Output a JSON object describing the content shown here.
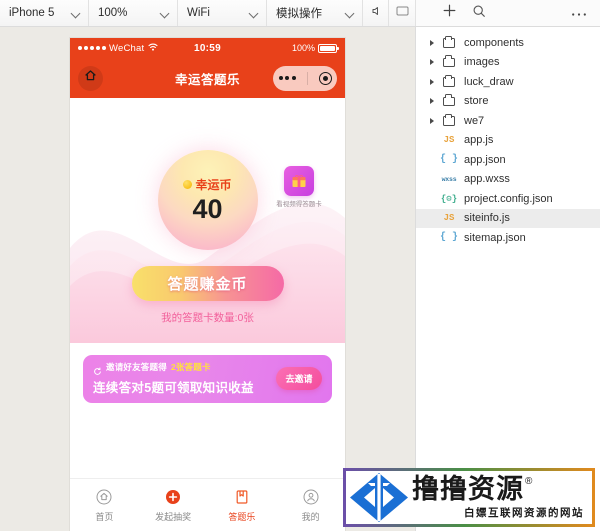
{
  "toolbar": {
    "device": "iPhone 5",
    "zoom": "100%",
    "network": "WiFi",
    "simulate": "模拟操作",
    "sound_icon": "speaker-icon",
    "screen_icon": "monitor-icon",
    "add_icon": "plus-icon",
    "search_icon": "search-icon",
    "more_icon": "more-horizontal-icon"
  },
  "phone": {
    "status": {
      "carrier": "WeChat",
      "time": "10:59",
      "battery": "100%",
      "wifi_icon": "wifi-icon",
      "signal_icon": "signal-dots-icon",
      "battery_icon": "battery-full-icon"
    },
    "nav": {
      "home_icon": "home-icon",
      "title": "幸运答题乐",
      "capsule_more_icon": "ellipsis-icon",
      "capsule_target_icon": "target-icon"
    },
    "hero": {
      "coin_icon": "coin-icon",
      "coin_label": "幸运币",
      "coin_value": "40",
      "video_icon": "gift-video-icon",
      "video_label": "看视频得答题卡",
      "main_button": "答题赚金币",
      "card_count": "我的答题卡数量:0张"
    },
    "invite": {
      "refresh_icon": "refresh-icon",
      "line1_prefix": "邀请好友答题得",
      "line1_highlight": "2张答题卡",
      "line2": "连续答对5题可领取知识收益",
      "button": "去邀请"
    },
    "tabs": [
      {
        "label": "首页",
        "icon": "home-outline-icon",
        "active": false
      },
      {
        "label": "发起抽奖",
        "icon": "plus-circle-icon",
        "active": false
      },
      {
        "label": "答题乐",
        "icon": "book-quiz-icon",
        "active": true
      },
      {
        "label": "我的",
        "icon": "user-circle-icon",
        "active": false
      }
    ]
  },
  "filetree": [
    {
      "name": "components",
      "type": "folder",
      "expandable": true,
      "selected": false,
      "icon": "folder-icon"
    },
    {
      "name": "images",
      "type": "folder",
      "expandable": true,
      "selected": false,
      "icon": "folder-icon"
    },
    {
      "name": "luck_draw",
      "type": "folder",
      "expandable": true,
      "selected": false,
      "icon": "folder-icon"
    },
    {
      "name": "store",
      "type": "folder",
      "expandable": true,
      "selected": false,
      "icon": "folder-icon"
    },
    {
      "name": "we7",
      "type": "folder",
      "expandable": true,
      "selected": false,
      "icon": "folder-icon"
    },
    {
      "name": "app.js",
      "type": "js",
      "expandable": false,
      "selected": false,
      "icon": "js-file-icon",
      "badge": "JS"
    },
    {
      "name": "app.json",
      "type": "json",
      "expandable": false,
      "selected": false,
      "icon": "json-file-icon",
      "badge": "{ }"
    },
    {
      "name": "app.wxss",
      "type": "wxss",
      "expandable": false,
      "selected": false,
      "icon": "wxss-file-icon",
      "badge": "wxss"
    },
    {
      "name": "project.config.json",
      "type": "cfg",
      "expandable": false,
      "selected": false,
      "icon": "config-file-icon",
      "badge": "{⚙}"
    },
    {
      "name": "siteinfo.js",
      "type": "js",
      "expandable": false,
      "selected": true,
      "icon": "js-file-icon",
      "badge": "JS"
    },
    {
      "name": "sitemap.json",
      "type": "json",
      "expandable": false,
      "selected": false,
      "icon": "json-file-icon",
      "badge": "{ }"
    }
  ],
  "watermark": {
    "title": "撸撸资源",
    "registered": "®",
    "subtitle": "白嫖互联网资源的网站",
    "logo_icon": "diamond-logo-icon"
  },
  "colors": {
    "wechat_orange": "#e8411a",
    "pink_accent": "#f25f9a",
    "invite_purple": "#e582ea",
    "highlight_yellow": "#ffe23d",
    "toolbar_bg": "#f7f7f7",
    "canvas_bg": "#eceae5"
  }
}
